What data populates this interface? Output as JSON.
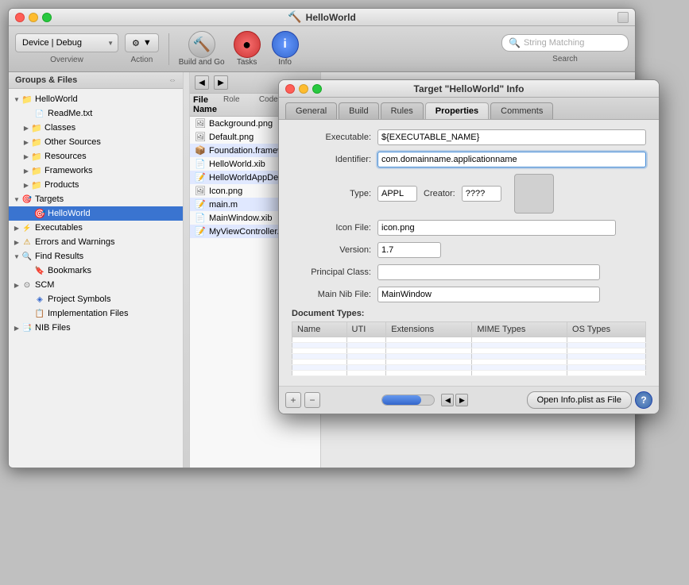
{
  "window": {
    "title": "HelloWorld",
    "titleIcon": "🔨"
  },
  "toolbar": {
    "scheme": "Device | Debug",
    "actionLabel": "Action",
    "buildAndGoLabel": "Build and Go",
    "tasksLabel": "Tasks",
    "infoLabel": "Info",
    "overviewLabel": "Overview",
    "actionSectionLabel": "Action",
    "searchLabel": "Search",
    "searchPlaceholder": "String Matching"
  },
  "sidebar": {
    "header": "Groups & Files",
    "items": [
      {
        "id": "helloworld-root",
        "label": "HelloWorld",
        "indent": 0,
        "type": "project",
        "state": "open"
      },
      {
        "id": "readme",
        "label": "ReadMe.txt",
        "indent": 1,
        "type": "file"
      },
      {
        "id": "classes",
        "label": "Classes",
        "indent": 1,
        "type": "folder",
        "state": "closed"
      },
      {
        "id": "other-sources",
        "label": "Other Sources",
        "indent": 1,
        "type": "folder",
        "state": "closed"
      },
      {
        "id": "resources",
        "label": "Resources",
        "indent": 1,
        "type": "folder",
        "state": "closed"
      },
      {
        "id": "frameworks",
        "label": "Frameworks",
        "indent": 1,
        "type": "folder",
        "state": "closed"
      },
      {
        "id": "products",
        "label": "Products",
        "indent": 1,
        "type": "folder",
        "state": "closed"
      },
      {
        "id": "targets",
        "label": "Targets",
        "indent": 0,
        "type": "target-group",
        "state": "open"
      },
      {
        "id": "helloworld-target",
        "label": "HelloWorld",
        "indent": 1,
        "type": "target",
        "selected": true
      },
      {
        "id": "executables",
        "label": "Executables",
        "indent": 0,
        "type": "exec-group",
        "state": "closed"
      },
      {
        "id": "errors-warnings",
        "label": "Errors and Warnings",
        "indent": 0,
        "type": "warning-group",
        "state": "closed"
      },
      {
        "id": "find-results",
        "label": "Find Results",
        "indent": 0,
        "type": "find-group",
        "state": "open"
      },
      {
        "id": "bookmarks",
        "label": "Bookmarks",
        "indent": 1,
        "type": "bookmark"
      },
      {
        "id": "scm",
        "label": "SCM",
        "indent": 0,
        "type": "scm-group",
        "state": "closed"
      },
      {
        "id": "project-symbols",
        "label": "Project Symbols",
        "indent": 1,
        "type": "project-sym"
      },
      {
        "id": "impl-files",
        "label": "Implementation Files",
        "indent": 1,
        "type": "impl"
      },
      {
        "id": "nib-files",
        "label": "NIB Files",
        "indent": 0,
        "type": "nib",
        "state": "closed"
      }
    ]
  },
  "filePanel": {
    "header": "File Name",
    "roleHeader": "Role",
    "codeHeader": "Code",
    "files": [
      {
        "name": "Background.png",
        "type": "image"
      },
      {
        "name": "Default.png",
        "type": "image"
      },
      {
        "name": "Foundation.framew",
        "type": "framework"
      },
      {
        "name": "HelloWorld.xib",
        "type": "xib"
      },
      {
        "name": "HelloWorldAppDele",
        "type": "m"
      },
      {
        "name": "Icon.png",
        "type": "image"
      },
      {
        "name": "main.m",
        "type": "m"
      },
      {
        "name": "MainWindow.xib",
        "type": "xib"
      },
      {
        "name": "MyViewController.",
        "type": "m"
      }
    ]
  },
  "infoDialog": {
    "title": "Target \"HelloWorld\" Info",
    "tabs": [
      "General",
      "Build",
      "Rules",
      "Properties",
      "Comments"
    ],
    "activeTab": "Properties",
    "fields": {
      "executableLabel": "Executable:",
      "executableValue": "${EXECUTABLE_NAME}",
      "identifierLabel": "Identifier:",
      "identifierValue": "com.domainname.applicationname",
      "typeLabel": "Type:",
      "typeValue": "APPL",
      "creatorLabel": "Creator:",
      "creatorValue": "????",
      "iconFileLabel": "Icon File:",
      "iconFileValue": "icon.png",
      "versionLabel": "Version:",
      "versionValue": "1.7",
      "principalClassLabel": "Principal Class:",
      "principalClassValue": "",
      "mainNibFileLabel": "Main Nib File:",
      "mainNibFileValue": "MainWindow"
    },
    "documentTypes": {
      "label": "Document Types:",
      "columns": [
        "Name",
        "UTI",
        "Extensions",
        "MIME Types",
        "OS Types"
      ],
      "rows": []
    },
    "footer": {
      "addLabel": "+",
      "removeLabel": "−",
      "openPlistLabel": "Open Info.plist as File",
      "helpLabel": "?"
    }
  }
}
